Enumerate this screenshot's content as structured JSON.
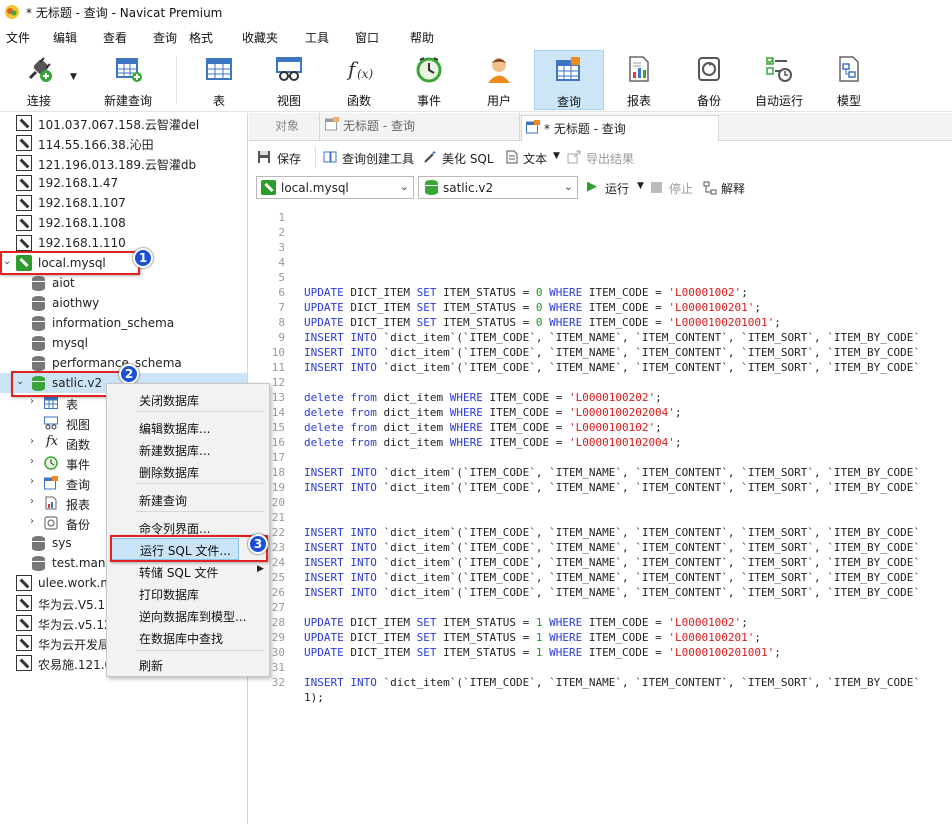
{
  "window": {
    "title": "* 无标题 - 查询 - Navicat Premium"
  },
  "menu": [
    "文件",
    "编辑",
    "查看",
    "查询",
    "格式",
    "收藏夹",
    "工具",
    "窗口",
    "帮助"
  ],
  "toolbar": {
    "connect": "连接",
    "new_query": "新建查询",
    "table": "表",
    "view": "视图",
    "function": "函数",
    "event": "事件",
    "user": "用户",
    "query": "查询",
    "report": "报表",
    "backup": "备份",
    "autorun": "自动运行",
    "model": "模型"
  },
  "tree": {
    "connections_top": [
      "101.037.067.158.云智灌del",
      "114.55.166.38.沁田",
      "121.196.013.189.云智灌db",
      "192.168.1.47",
      "192.168.1.107",
      "192.168.1.108",
      "192.168.1.110"
    ],
    "local": "local.mysql",
    "dbs_before": [
      "aiot",
      "aiothwy",
      "information_schema",
      "mysql",
      "performance_schema"
    ],
    "selected_db": "satlic.v2",
    "sub": [
      "表",
      "视图",
      "函数",
      "事件",
      "查询",
      "报表",
      "备份"
    ],
    "dbs_after": [
      "sys",
      "test.mana"
    ],
    "connections_bottom": [
      "ulee.work.m",
      "华为云.V5.12",
      "华为云.v5.12",
      "华为云开发局",
      "农易施.121.0"
    ]
  },
  "badges": [
    "1",
    "2",
    "3"
  ],
  "context_menu": {
    "items": [
      "关闭数据库",
      "编辑数据库...",
      "新建数据库...",
      "删除数据库",
      "新建查询",
      "命令列界面...",
      "运行 SQL 文件...",
      "转储 SQL 文件",
      "打印数据库",
      "逆向数据库到模型...",
      "在数据库中查找",
      "刷新"
    ]
  },
  "tabs": {
    "objects": "对象",
    "tab1": "无标题 - 查询",
    "tab2": "* 无标题 - 查询"
  },
  "query_toolbar": {
    "save": "保存",
    "builder": "查询创建工具",
    "beautify": "美化 SQL",
    "text": "文本",
    "export": "导出结果"
  },
  "selectors": {
    "connection": "local.mysql",
    "database": "satlic.v2",
    "run": "运行",
    "stop": "停止",
    "explain": "解释"
  },
  "editor": {
    "line_numbers": [
      "1",
      "2",
      "3",
      "4",
      "5",
      "6",
      "7",
      "8",
      "9",
      "10",
      "11",
      "12",
      "13",
      "14",
      "15",
      "16",
      "17",
      "18",
      "19",
      "20",
      "21",
      "22",
      "23",
      "24",
      "25",
      "26",
      "27",
      "28",
      "29",
      "30",
      "31",
      "32"
    ],
    "upd1": "UPDATE DICT_ITEM SET ITEM_STATUS = 0 WHERE ITEM_CODE = 'L00001002';",
    "upd2": "UPDATE DICT_ITEM SET ITEM_STATUS = 0 WHERE ITEM_CODE = 'L0000100201';",
    "upd3": "UPDATE DICT_ITEM SET ITEM_STATUS = 0 WHERE ITEM_CODE = 'L0000100201001';",
    "ins": "INSERT INTO `dict_item`(`ITEM_CODE`, `ITEM_NAME`, `ITEM_CONTENT`, `ITEM_SORT`, `ITEM_BY_CODE`",
    "del1": "delete from dict_item WHERE ITEM_CODE = 'L0000100202';",
    "del2": "delete from dict_item WHERE ITEM_CODE = 'L0000100202004';",
    "del3": "delete from dict_item WHERE ITEM_CODE = 'L0000100102';",
    "del4": "delete from dict_item WHERE ITEM_CODE = 'L0000100102004';",
    "upd4": "UPDATE DICT_ITEM SET ITEM_STATUS = 1 WHERE ITEM_CODE = 'L00001002';",
    "upd5": "UPDATE DICT_ITEM SET ITEM_STATUS = 1 WHERE ITEM_CODE = 'L0000100201';",
    "upd6": "UPDATE DICT_ITEM SET ITEM_STATUS = 1 WHERE ITEM_CODE = 'L0000100201001';",
    "tail": "1);"
  }
}
